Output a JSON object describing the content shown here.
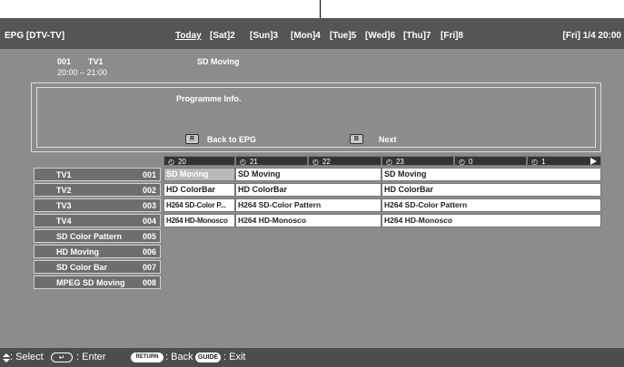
{
  "header": {
    "title": "EPG [DTV-TV]",
    "today": "Today",
    "days": [
      "[Sat]2",
      "[Sun]3",
      "[Mon]4",
      "[Tue]5",
      "[Wed]6",
      "[Thu]7",
      "[Fri]8"
    ],
    "current_date": "[Fri] 1/4 20:00"
  },
  "programme": {
    "number": "001",
    "channel": "TV1",
    "time": "20:00 – 21:00",
    "name": "SD Moving"
  },
  "info_panel": {
    "label": "Programme Info.",
    "back_key": "R",
    "back_label": "Back to EPG",
    "next_key": "B",
    "next_label": "Next"
  },
  "timeline": {
    "hours": [
      "20",
      "21",
      "22",
      "23",
      "0",
      "1"
    ]
  },
  "channels": [
    {
      "name": "TV1",
      "number": "001"
    },
    {
      "name": "TV2",
      "number": "002"
    },
    {
      "name": "TV3",
      "number": "003"
    },
    {
      "name": "TV4",
      "number": "004"
    },
    {
      "name": "SD Color Pattern",
      "number": "005"
    },
    {
      "name": "HD Moving",
      "number": "006"
    },
    {
      "name": "SD Color Bar",
      "number": "007"
    },
    {
      "name": "MPEG SD Moving",
      "number": "008"
    }
  ],
  "grid": [
    [
      "SD Moving",
      "SD Moving",
      "SD Moving"
    ],
    [
      "HD ColorBar",
      "HD ColorBar",
      "HD ColorBar"
    ],
    [
      "H264 SD-Color P...",
      "H264 SD-Color Pattern",
      "H264 SD-Color Pattern"
    ],
    [
      "H264 HD-Monosco",
      "H264 HD-Monosco",
      "H264 HD-Monosco"
    ]
  ],
  "footer": {
    "select_label": ": Select",
    "enter_icon": "↵",
    "enter_label": ": Enter",
    "return_icon": "RETURN",
    "back_label": ": Back",
    "guide_icon": "GUIDE",
    "exit_label": ": Exit"
  },
  "colors": {
    "screen_bg": "#8c8c8c",
    "topbar_bg": "#555555",
    "selected_cell": "#b9b9b9"
  }
}
